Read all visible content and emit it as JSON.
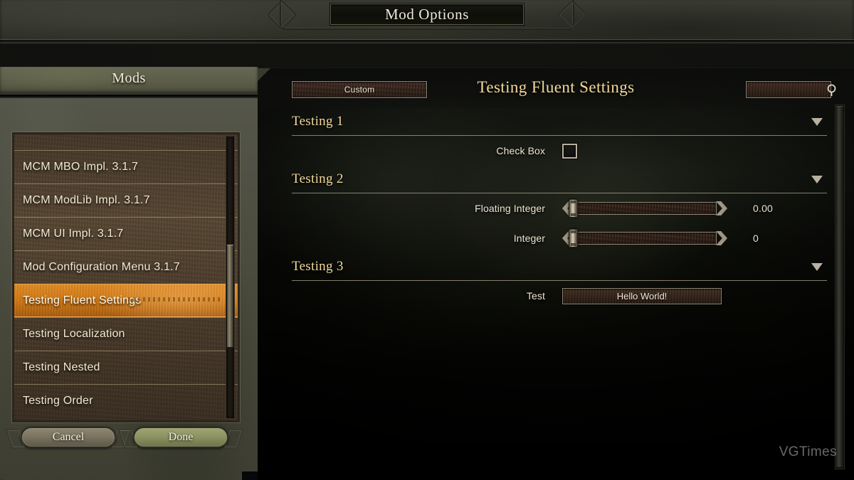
{
  "window": {
    "title": "Mod Options"
  },
  "sidebar": {
    "header": "Mods",
    "items": [
      {
        "label": "MCM MBO Impl. 3.1.7",
        "selected": false
      },
      {
        "label": "MCM ModLib Impl. 3.1.7",
        "selected": false
      },
      {
        "label": "MCM UI Impl. 3.1.7",
        "selected": false
      },
      {
        "label": "Mod Configuration Menu 3.1.7",
        "selected": false
      },
      {
        "label": "Testing Fluent Settings",
        "selected": true
      },
      {
        "label": "Testing Localization",
        "selected": false
      },
      {
        "label": "Testing Nested",
        "selected": false
      },
      {
        "label": "Testing Order",
        "selected": false
      }
    ],
    "buttons": {
      "cancel": "Cancel",
      "done": "Done"
    }
  },
  "main": {
    "preset_button": "Custom",
    "title": "Testing Fluent Settings",
    "search": {
      "value": "",
      "placeholder": "",
      "icon": "search-icon"
    },
    "sections": [
      {
        "label": "Testing 1",
        "expand_icon": "chevron-down-icon",
        "settings": [
          {
            "label": "Check Box",
            "type": "checkbox",
            "checked": false,
            "value": ""
          }
        ]
      },
      {
        "label": "Testing 2",
        "expand_icon": "chevron-down-icon",
        "settings": [
          {
            "label": "Floating Integer",
            "type": "slider",
            "value": "0.00",
            "fill_percent": 0
          },
          {
            "label": "Integer",
            "type": "slider",
            "value": "0",
            "fill_percent": 0
          }
        ]
      },
      {
        "label": "Testing 3",
        "expand_icon": "chevron-down-icon",
        "settings": [
          {
            "label": "Test",
            "type": "button",
            "value": "Hello World!"
          }
        ]
      }
    ]
  },
  "watermark": "VGTimes",
  "colors": {
    "accent_selected": "#cd7613",
    "title_gold": "#f3d999",
    "text_cream": "#ece4d0",
    "done_green": "#8d9263",
    "panel_brown": "#5a4833"
  }
}
